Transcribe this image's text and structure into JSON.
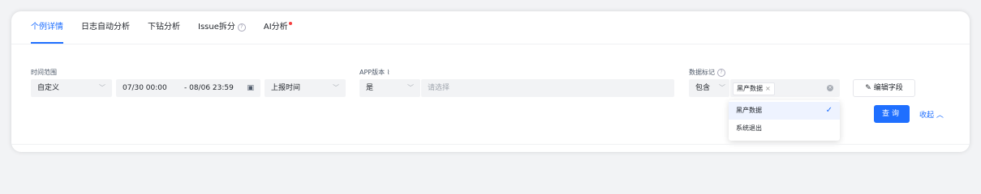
{
  "tabs": [
    {
      "label": "个例详情",
      "active": true
    },
    {
      "label": "日志自动分析"
    },
    {
      "label": "下钻分析"
    },
    {
      "label": "Issue拆分"
    },
    {
      "label": "AI分析"
    }
  ],
  "filters": {
    "time_range": {
      "label": "时间范围",
      "mode": "自定义",
      "start": "07/30 00:00",
      "end": "- 08/06 23:59",
      "time_type": "上报时间"
    },
    "app_version": {
      "label": "APP版本",
      "operator": "是",
      "placeholder": "请选择"
    },
    "data_tag": {
      "label": "数据标记",
      "operator": "包含",
      "selected_tag": "黑产数据",
      "options": [
        "黑产数据",
        "系统退出"
      ]
    }
  },
  "buttons": {
    "edit_fields": "编辑字段",
    "query": "查询",
    "collapse": "收起"
  },
  "colors": {
    "accent": "#1f6fff",
    "dot": "#f53f3f"
  }
}
